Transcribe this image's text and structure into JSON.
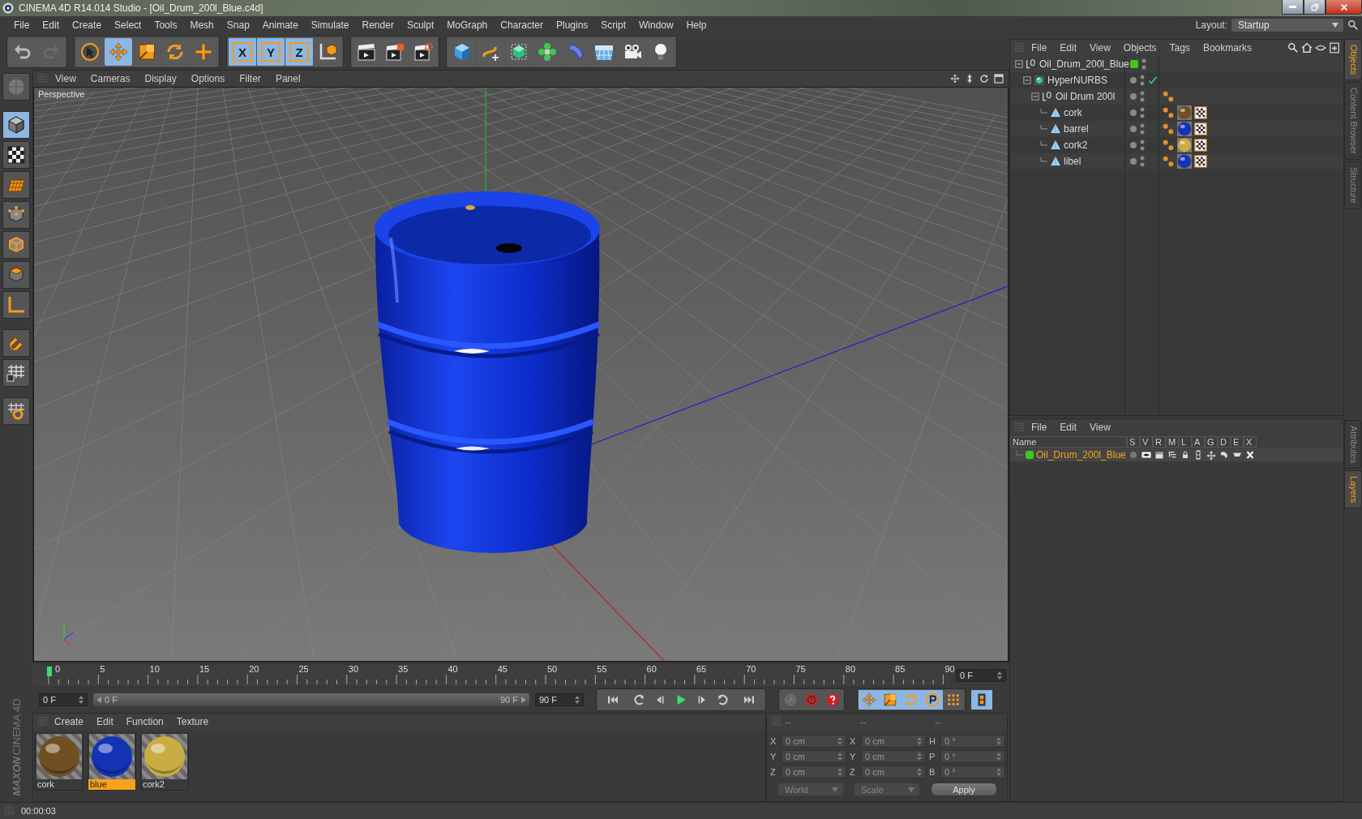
{
  "window": {
    "title": "CINEMA 4D R14.014 Studio - [Oil_Drum_200l_Blue.c4d]"
  },
  "menu": [
    "File",
    "Edit",
    "Create",
    "Select",
    "Tools",
    "Mesh",
    "Snap",
    "Animate",
    "Simulate",
    "Render",
    "Sculpt",
    "MoGraph",
    "Character",
    "Plugins",
    "Script",
    "Window",
    "Help"
  ],
  "layout": {
    "label": "Layout:",
    "value": "Startup"
  },
  "toolbar": [
    [
      {
        "kind": "undo",
        "selected": false
      },
      {
        "kind": "redo",
        "selected": false
      }
    ],
    [
      {
        "kind": "select",
        "selected": false
      },
      {
        "kind": "move",
        "selected": true
      },
      {
        "kind": "scale",
        "selected": false
      },
      {
        "kind": "rotate",
        "selected": false
      },
      {
        "kind": "add",
        "selected": false
      }
    ],
    [
      {
        "kind": "axis-lock",
        "label": "X",
        "selected": true
      },
      {
        "kind": "axis-lock",
        "label": "Y",
        "selected": true
      },
      {
        "kind": "axis-lock",
        "label": "Z",
        "selected": true
      },
      {
        "kind": "coords",
        "selected": false
      }
    ],
    [
      {
        "kind": "render-view",
        "selected": false
      },
      {
        "kind": "render",
        "selected": false
      },
      {
        "kind": "render-settings",
        "selected": false
      }
    ],
    [
      {
        "kind": "cube",
        "selected": false
      },
      {
        "kind": "spline",
        "selected": false
      },
      {
        "kind": "nurbs",
        "selected": false
      },
      {
        "kind": "cloner",
        "selected": false
      },
      {
        "kind": "deformer",
        "selected": false
      },
      {
        "kind": "floor",
        "selected": false
      },
      {
        "kind": "camera",
        "selected": false
      },
      {
        "kind": "light",
        "selected": false
      }
    ]
  ],
  "left_tools": [
    {
      "kind": "make-editable",
      "selected": false
    },
    {
      "kind": "model",
      "selected": true
    },
    {
      "kind": "texture",
      "selected": false
    },
    {
      "kind": "workplane",
      "selected": false
    },
    {
      "kind": "points",
      "selected": false
    },
    {
      "kind": "edges",
      "selected": false
    },
    {
      "kind": "polygons",
      "selected": false
    },
    {
      "kind": "axis",
      "selected": false
    },
    {
      "kind": "snap",
      "selected": false
    },
    {
      "kind": "grid-lock",
      "selected": false
    },
    {
      "kind": "grid-snap",
      "selected": false
    }
  ],
  "viewport": {
    "menu": [
      "View",
      "Cameras",
      "Display",
      "Options",
      "Filter",
      "Panel"
    ],
    "camera_label": "Perspective"
  },
  "object_manager": {
    "menu": [
      "File",
      "Edit",
      "View",
      "Objects",
      "Tags",
      "Bookmarks"
    ],
    "objects": [
      {
        "name": "Oil_Drum_200l_Blue",
        "kind": "null",
        "expanded": true,
        "color": "#3ec81a",
        "children": [
          {
            "name": "HyperNURBS",
            "kind": "hypernurbs",
            "expanded": true,
            "enabled": true,
            "children": [
              {
                "name": "Oil Drum 200l",
                "kind": "null",
                "expanded": true,
                "tags": [
                  {
                    "kind": "phong"
                  }
                ],
                "children": [
                  {
                    "name": "cork",
                    "kind": "polygon",
                    "tags": [
                      {
                        "kind": "phong"
                      },
                      {
                        "kind": "material",
                        "color": "#6e5022"
                      },
                      {
                        "kind": "uvw"
                      }
                    ]
                  },
                  {
                    "name": "barrel",
                    "kind": "polygon",
                    "tags": [
                      {
                        "kind": "phong"
                      },
                      {
                        "kind": "material",
                        "color": "#1432b4"
                      },
                      {
                        "kind": "uvw"
                      }
                    ]
                  },
                  {
                    "name": "cork2",
                    "kind": "polygon",
                    "tags": [
                      {
                        "kind": "phong"
                      },
                      {
                        "kind": "material",
                        "color": "#c8ac44"
                      },
                      {
                        "kind": "uvw"
                      }
                    ]
                  },
                  {
                    "name": "libel",
                    "kind": "polygon",
                    "tags": [
                      {
                        "kind": "phong"
                      },
                      {
                        "kind": "material",
                        "color": "#1432b4"
                      },
                      {
                        "kind": "uvw"
                      }
                    ]
                  }
                ]
              }
            ]
          }
        ]
      }
    ]
  },
  "side_tabs_top": [
    {
      "label": "Objects",
      "selected": true
    },
    {
      "label": "Content Browser",
      "selected": false
    },
    {
      "label": "Structure",
      "selected": false
    }
  ],
  "side_tabs_bottom": [
    {
      "label": "Attributes",
      "selected": false
    },
    {
      "label": "Layers",
      "selected": true
    }
  ],
  "layer_manager": {
    "menu": [
      "File",
      "Edit",
      "View"
    ],
    "columns": [
      "Name",
      "S",
      "V",
      "R",
      "M",
      "L",
      "A",
      "G",
      "D",
      "E",
      "X"
    ],
    "layers": [
      {
        "name": "Oil_Drum_200l_Blue",
        "color": "#3ec81a"
      }
    ]
  },
  "timeline": {
    "ruler_labels": [
      "0",
      "5",
      "10",
      "15",
      "20",
      "25",
      "30",
      "35",
      "40",
      "45",
      "50",
      "55",
      "60",
      "65",
      "70",
      "75",
      "80",
      "85",
      "90"
    ],
    "playhead": {
      "level": 0
    },
    "current_frame": "0 F",
    "start_field": "0 F",
    "range": {
      "start": "0 F",
      "end": "90 F",
      "level": 1
    },
    "end_field": "90 F",
    "transport": [
      {
        "kind": "first"
      },
      {
        "kind": "prev-key"
      },
      {
        "kind": "prev-frame"
      },
      {
        "kind": "play"
      },
      {
        "kind": "next-frame"
      },
      {
        "kind": "next-key"
      },
      {
        "kind": "last"
      }
    ],
    "record": [
      {
        "kind": "autokey",
        "disabled": true
      },
      {
        "kind": "record",
        "disabled": false
      },
      {
        "kind": "help",
        "disabled": false
      }
    ],
    "key_modes": [
      {
        "kind": "move",
        "selected": true
      },
      {
        "kind": "scale",
        "selected": true
      },
      {
        "kind": "rotate",
        "selected": true
      },
      {
        "kind": "param",
        "selected": true
      },
      {
        "kind": "pla",
        "selected": false
      }
    ]
  },
  "material_manager": {
    "menu": [
      "Create",
      "Edit",
      "Function",
      "Texture"
    ],
    "materials": [
      {
        "name": "cork",
        "color": "#6e5022",
        "selected": false
      },
      {
        "name": "blue",
        "color": "#1432b4",
        "selected": true
      },
      {
        "name": "cork2",
        "color": "#c8ac44",
        "selected": false
      }
    ]
  },
  "logo": {
    "brand": "MAXON",
    "product": "CINEMA 4D"
  },
  "coordinates": {
    "headers": [
      "--",
      "--",
      "--"
    ],
    "rows": [
      [
        {
          "axis": "X",
          "value": "0 cm"
        },
        {
          "axis": "X",
          "value": "0 cm"
        },
        {
          "axis": "H",
          "value": "0 °"
        }
      ],
      [
        {
          "axis": "Y",
          "value": "0 cm"
        },
        {
          "axis": "Y",
          "value": "0 cm"
        },
        {
          "axis": "P",
          "value": "0 °"
        }
      ],
      [
        {
          "axis": "Z",
          "value": "0 cm"
        },
        {
          "axis": "Z",
          "value": "0 cm"
        },
        {
          "axis": "B",
          "value": "0 °"
        }
      ]
    ],
    "dropdowns": [
      "World",
      "Scale"
    ],
    "apply": "Apply"
  },
  "status_bar": {
    "text": "00:00:03"
  }
}
